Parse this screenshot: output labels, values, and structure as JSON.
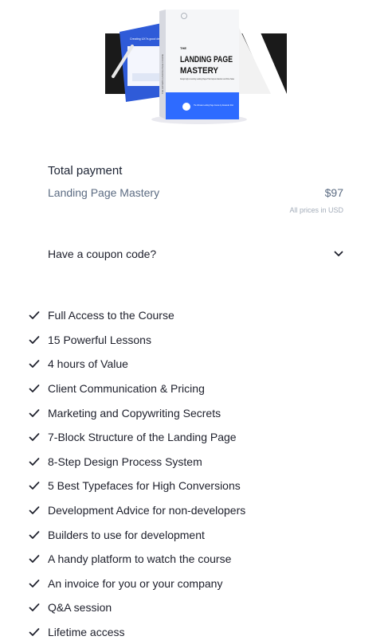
{
  "hero": {
    "box_title_line1": "LANDING PAGE",
    "box_title_line2": "MASTERY",
    "box_small_top": "THE",
    "box_tagline": "Design High-converting Landing Pages That Capture Attention and Drive Sales",
    "box_spine": "THE ULTIMATE LANDING PAGE COURSE",
    "box_author_note": "The Ultimate Landing Page Course by Alexander Ruiz",
    "screen_text": "Creating UX?s good design for your projects",
    "colors": {
      "blue": "#2f5bd8",
      "dark": "#1a1a1a",
      "accent": "#2e6bff"
    }
  },
  "payment": {
    "title": "Total payment",
    "product_name": "Landing Page Mastery",
    "price": "$97",
    "prices_note": "All prices in USD"
  },
  "coupon": {
    "label": "Have a coupon code?"
  },
  "features": [
    "Full Access to the Course",
    "15 Powerful Lessons",
    "4 hours of Value",
    "Client Communication & Pricing",
    "Marketing and Copywriting Secrets",
    "7-Block Structure of the Landing Page",
    "8-Step Design Process System",
    "5 Best Typefaces for High Conversions",
    "Development Advice for non-developers",
    "Builders to use for development",
    "A handy platform to watch the course",
    "An invoice for you or your company",
    "Q&A session",
    "Lifetime access"
  ]
}
